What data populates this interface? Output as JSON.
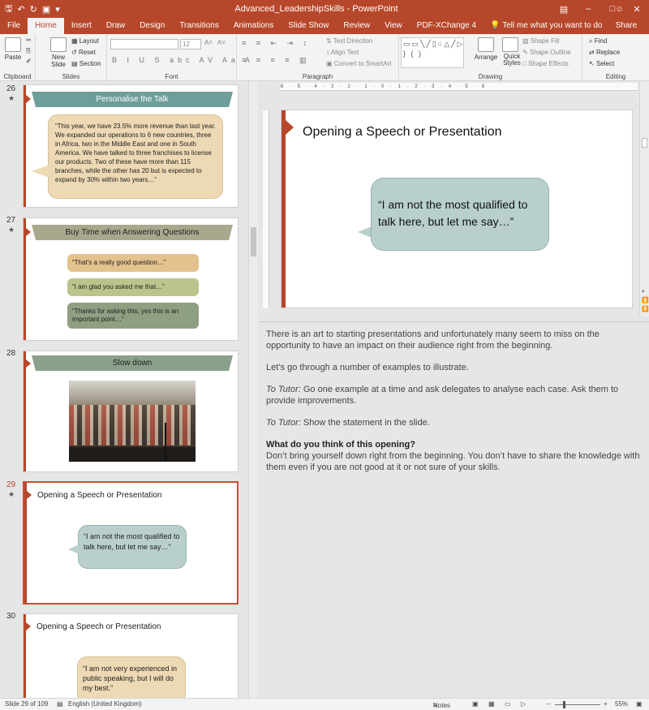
{
  "window": {
    "title": "Advanced_LeadershipSkills  -  PowerPoint",
    "controls": [
      "–",
      "□",
      "✕"
    ],
    "qat_icons": [
      "save-icon",
      "undo-icon",
      "redo-icon",
      "start-slideshow-icon",
      "customize-qat-icon"
    ]
  },
  "tabs": {
    "items": [
      "File",
      "Home",
      "Insert",
      "Draw",
      "Design",
      "Transitions",
      "Animations",
      "Slide Show",
      "Review",
      "View",
      "PDF-XChange 4"
    ],
    "active": "Home",
    "tell_me": "Tell me what you want to do",
    "share": "Share"
  },
  "ribbon": {
    "clipboard": {
      "label": "Clipboard",
      "paste": "Paste"
    },
    "slides": {
      "label": "Slides",
      "new_slide": "New Slide",
      "layout": "Layout",
      "reset": "Reset",
      "section": "Section"
    },
    "font": {
      "label": "Font",
      "size": "12"
    },
    "paragraph": {
      "label": "Paragraph",
      "text_direction": "Text Direction",
      "align_text": "Align Text",
      "convert_smartart": "Convert to SmartArt"
    },
    "drawing": {
      "label": "Drawing",
      "arrange": "Arrange",
      "quick_styles": "Quick Styles",
      "shape_fill": "Shape Fill",
      "shape_outline": "Shape Outline",
      "shape_effects": "Shape Effects"
    },
    "editing": {
      "label": "Editing",
      "find": "Find",
      "replace": "Replace",
      "select": "Select"
    }
  },
  "thumbnails": {
    "s26": {
      "num": "26",
      "title": "Personalise the Talk",
      "text": "“This year, we have 23.5% more revenue than last year. We expanded our operations to 6 new countries, three in Africa, two in the Middle East and one in South America. We have talked to three franchises to license our products. Two of these have more than 115 branches, while the other has 20 but is expected to expand by 30% within two years…”"
    },
    "s27": {
      "num": "27",
      "title": "Buy Time when Answering Questions",
      "items": [
        "“That’s a really good question…”",
        "“I am glad you asked me that…”",
        "“Thanks for asking this, yes this is an important point…”"
      ]
    },
    "s28": {
      "num": "28",
      "title": "Slow down"
    },
    "s29": {
      "num": "29",
      "title": "Opening a Speech or Presentation",
      "text": "“I am not the most qualified to talk here, but let me say…”"
    },
    "s30": {
      "num": "30",
      "title": "Opening a Speech or Presentation",
      "text": "“I am not very experienced in public speaking, but I will do my best.”"
    }
  },
  "main_slide": {
    "title": "Opening a Speech or Presentation",
    "quote": "“I am not the most qualified to talk here, but let me say…”"
  },
  "ruler": {
    "top_ticks": "6 · 5 · 4 · 3 · 2 · 1 · 0 · 1 · 2 · 3 · 4 · 5 · 6"
  },
  "notes": {
    "p1": "There is an art to starting presentations and unfortunately many seem to miss on the opportunity to have an impact on their audience right from the beginning.",
    "p2": "Let’s go through a number of examples to illustrate.",
    "p3_label": "To Tutor:",
    "p3_text": " Go one example at a time and ask delegates to analyse each case. Ask them to provide improvements.",
    "p4_label": "To Tutor:",
    "p4_text": " Show the statement in the slide.",
    "p5_heading": "What do you think of this opening?",
    "p5_text": "Don’t bring yourself down right from the beginning. You don’t have to share the knowledge with them even if you are not good at it or not sure of your skills."
  },
  "status": {
    "slide_info": "Slide 29 of 109",
    "language": "English (United Kingdom)",
    "notes_label": "Notes",
    "zoom": "55%",
    "zoom_level_percent": 55
  },
  "colors": {
    "accent": "#b7472a",
    "teal": "#b8cfcd",
    "sand": "#edd9b4"
  }
}
